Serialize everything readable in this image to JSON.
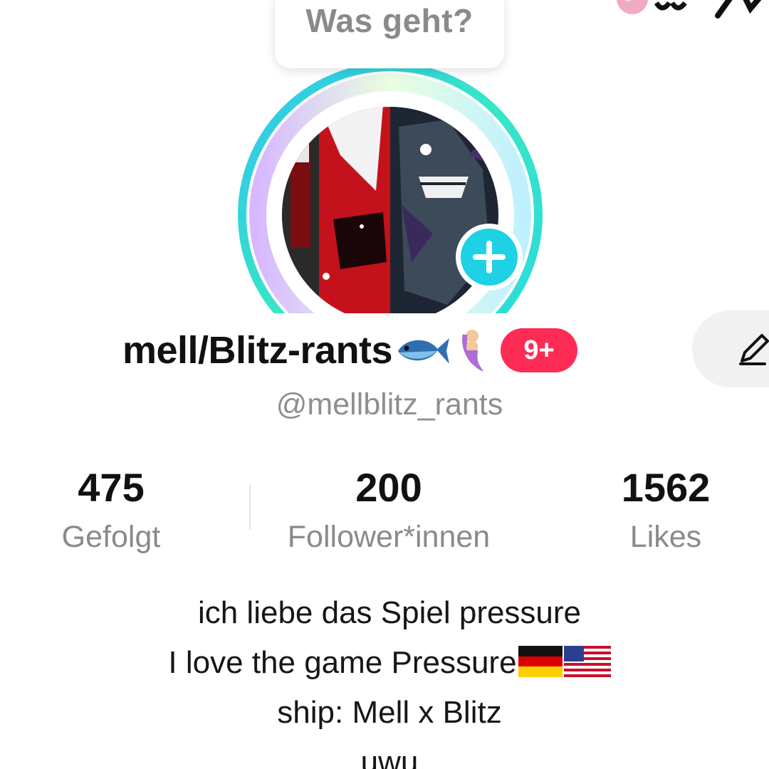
{
  "status_bubble": {
    "text": "Was geht?"
  },
  "profile": {
    "display_name": "mell/Blitz-rants",
    "name_emojis": [
      "fish-icon",
      "mermaid-icon"
    ],
    "notification_badge": "9+",
    "handle": "@mellblitz_rants"
  },
  "stats": {
    "following": {
      "value": "475",
      "label": "Gefolgt"
    },
    "followers": {
      "value": "200",
      "label": "Follower*innen"
    },
    "likes": {
      "value": "1562",
      "label": "Likes"
    }
  },
  "bio": {
    "lines": [
      "ich liebe das Spiel pressure",
      "I love the game Pressure",
      "ship: Mell x Blitz",
      "uwu"
    ],
    "line2_flags": [
      "germany-flag-icon",
      "usa-flag-icon"
    ]
  },
  "colors": {
    "accent_cyan": "#1fd1e4",
    "badge_red": "#fe2c55",
    "text_primary": "#111111",
    "text_secondary": "#8a8a8a"
  }
}
